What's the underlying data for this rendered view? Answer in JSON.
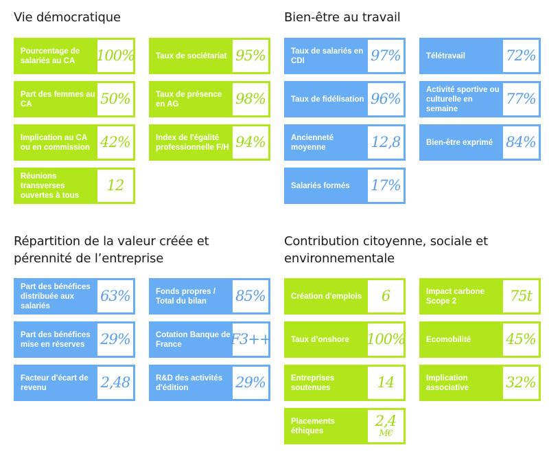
{
  "colors": {
    "green": "#b2e61c",
    "blue": "#68acf3",
    "title": "#1a1a1a"
  },
  "sections": [
    {
      "title": "Vie démocratique",
      "theme": "green",
      "cards": [
        {
          "label": "Pourcentage de salariés au CA",
          "value": "100%"
        },
        {
          "label": "Taux de sociétariat",
          "value": "95%"
        },
        {
          "label": "Part des femmes au CA",
          "value": "50%"
        },
        {
          "label": "Taux de présence en AG",
          "value": "98%"
        },
        {
          "label": "Implication au CA ou en commission",
          "value": "42%"
        },
        {
          "label": "Index de l'égalité professionnelle F/H",
          "value": "94%"
        },
        {
          "label": "Réunions transverses ouvertes à tous",
          "value": "12"
        }
      ]
    },
    {
      "title": "Bien-être au travail",
      "theme": "blue",
      "cards": [
        {
          "label": "Taux de salariés en CDI",
          "value": "97%"
        },
        {
          "label": "Télétravail",
          "value": "72%"
        },
        {
          "label": "Taux de fidélisation",
          "value": "96%"
        },
        {
          "label": "Activité sportive ou culturelle en semaine",
          "value": "77%"
        },
        {
          "label": "Ancienneté moyenne",
          "value": "12,8"
        },
        {
          "label": "Bien-être exprimé",
          "value": "84%"
        },
        {
          "label": "Salariés formés",
          "value": "17%"
        }
      ]
    },
    {
      "title_lines": [
        "Répartition de la valeur créée et",
        "pérennité de l’entreprise"
      ],
      "theme": "blue",
      "cards": [
        {
          "label": "Part des bénéfices distribuée aux salariés",
          "value": "63%"
        },
        {
          "label": "Fonds propres / Total du bilan",
          "value": "85%"
        },
        {
          "label": "Part des bénéfices mise en réserves",
          "value": "29%"
        },
        {
          "label": "Cotation Banque de France",
          "value": "F3++"
        },
        {
          "label": "Facteur d'écart de revenu",
          "value": "2,48"
        },
        {
          "label": "R&D des activités d'édition",
          "value": "29%"
        }
      ]
    },
    {
      "title_lines": [
        "Contribution citoyenne, sociale et",
        "environnementale"
      ],
      "theme": "green",
      "cards": [
        {
          "label": "Création d'emplois",
          "value": "6"
        },
        {
          "label": "Impact carbone Scope 2",
          "value": "75t"
        },
        {
          "label": "Taux d’onshore",
          "value": "100%"
        },
        {
          "label": "Ecomobilité",
          "value": "45%"
        },
        {
          "label": "Entreprises soutenues",
          "value": "14"
        },
        {
          "label": "Implication associative",
          "value": "32%"
        },
        {
          "label": "Placements éthiques",
          "value": "2,4",
          "unit": "M€"
        }
      ]
    }
  ]
}
